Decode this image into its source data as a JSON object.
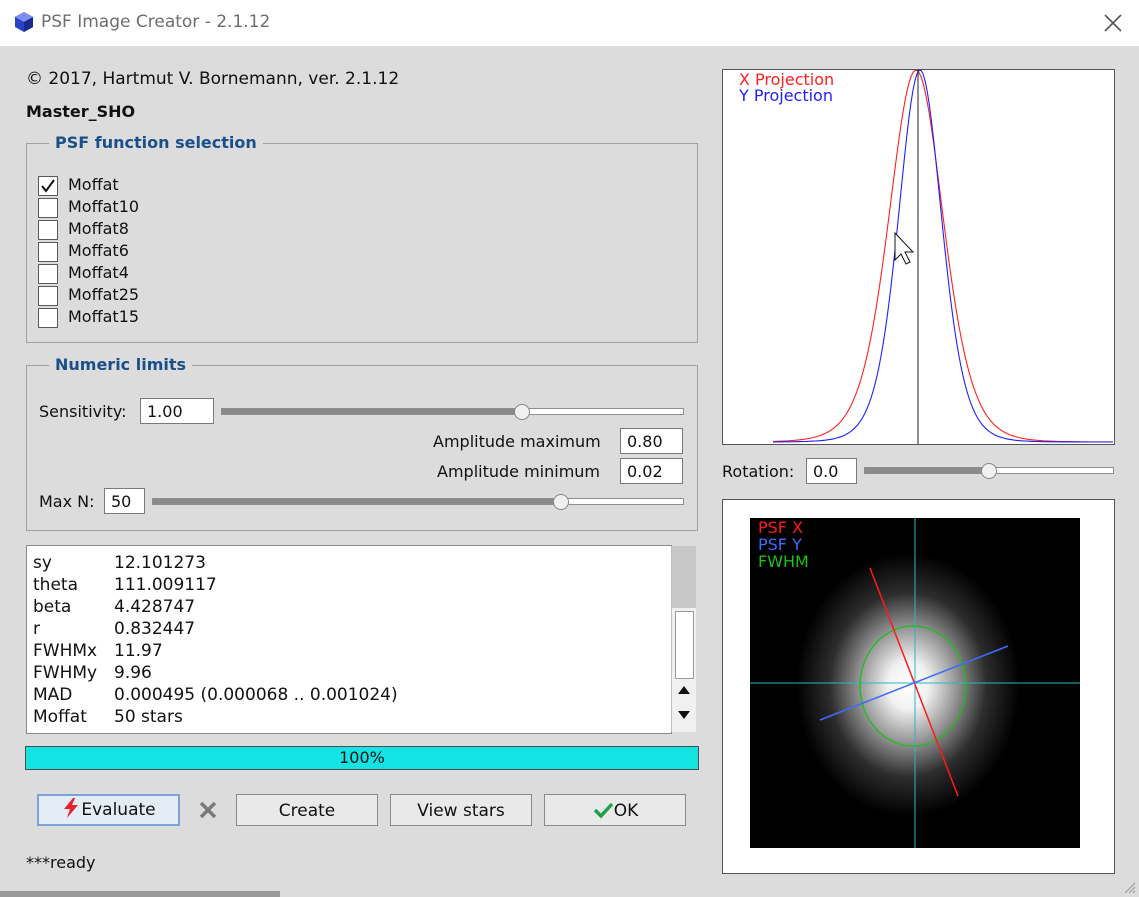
{
  "window": {
    "title": "PSF Image Creator - 2.1.12"
  },
  "header": {
    "copyright": "© 2017, Hartmut V. Bornemann, ver. 2.1.12",
    "document": "Master_SHO"
  },
  "psf_selection": {
    "title": "PSF function selection",
    "options": [
      {
        "label": "Moffat",
        "checked": true
      },
      {
        "label": "Moffat10",
        "checked": false
      },
      {
        "label": "Moffat8",
        "checked": false
      },
      {
        "label": "Moffat6",
        "checked": false
      },
      {
        "label": "Moffat4",
        "checked": false
      },
      {
        "label": "Moffat25",
        "checked": false
      },
      {
        "label": "Moffat15",
        "checked": false
      }
    ]
  },
  "numeric_limits": {
    "title": "Numeric limits",
    "sensitivity_label": "Sensitivity:",
    "sensitivity_value": "1.00",
    "sensitivity_slider": 0.65,
    "amplitude_max_label": "Amplitude maximum",
    "amplitude_max_value": "0.80",
    "amplitude_min_label": "Amplitude minimum",
    "amplitude_min_value": "0.02",
    "maxn_label": "Max N:",
    "maxn_value": "50",
    "maxn_slider": 0.77
  },
  "results": [
    {
      "key": "sy",
      "value": "12.101273"
    },
    {
      "key": "theta",
      "value": "111.009117"
    },
    {
      "key": "beta",
      "value": "4.428747"
    },
    {
      "key": "r",
      "value": "0.832447"
    },
    {
      "key": "FWHMx",
      "value": "11.97"
    },
    {
      "key": "FWHMy",
      "value": "9.96"
    },
    {
      "key": "MAD",
      "value": "0.000495 (0.000068 .. 0.001024)"
    },
    {
      "key": "Moffat",
      "value": "50 stars"
    }
  ],
  "progress": {
    "label": "100%",
    "value": 1.0
  },
  "buttons": {
    "evaluate": "Evaluate",
    "create": "Create",
    "view_stars": "View stars",
    "ok": "OK"
  },
  "status": "***ready",
  "projection_plot": {
    "legend_x": "X Projection",
    "legend_y": "Y Projection",
    "color_x": "#ff2020",
    "color_y": "#2020ff"
  },
  "rotation": {
    "label": "Rotation:",
    "value": "0.0",
    "slider": 0.5
  },
  "psf_image": {
    "legend_x": "PSF X",
    "legend_y": "PSF Y",
    "legend_fwhm": "FWHM",
    "color_x": "#ff1a1a",
    "color_y": "#3d6dff",
    "color_fwhm": "#19c019",
    "crosshair_color": "#2ab7c7"
  },
  "colors": {
    "accent_blue": "#1b4f8a",
    "progress_fill": "#14e3e3",
    "background": "#dcdcdc"
  }
}
